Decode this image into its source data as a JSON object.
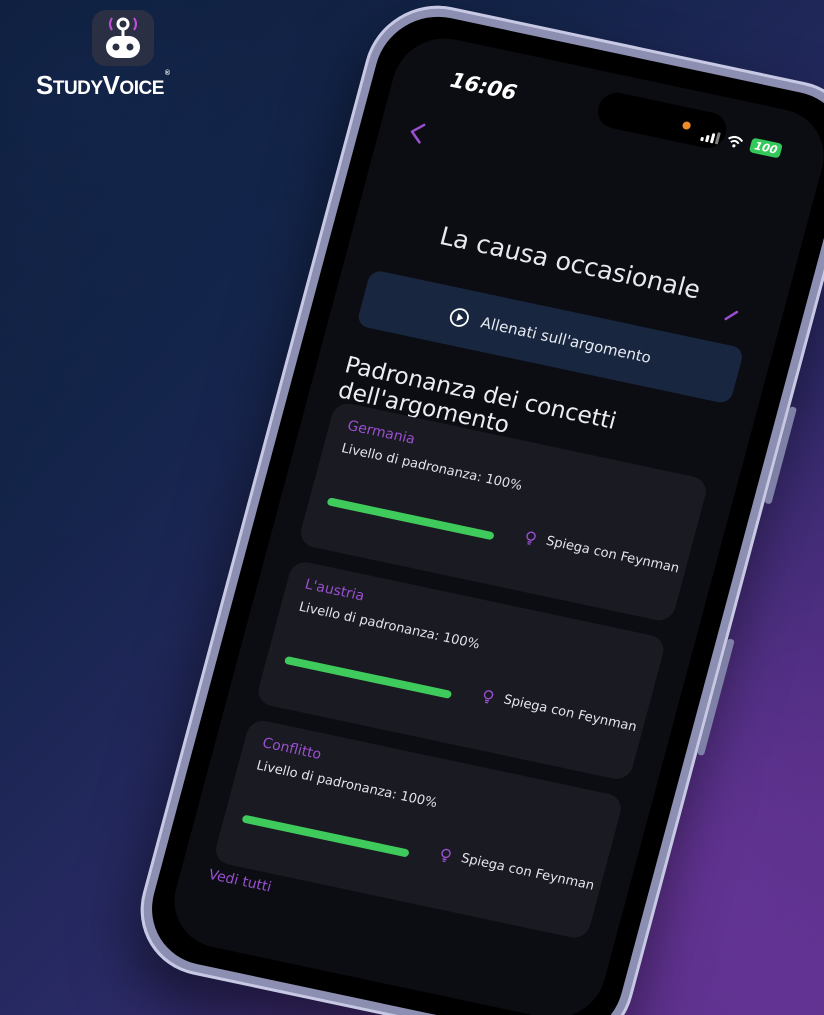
{
  "branding": {
    "logo_text_main_1": "S",
    "logo_text_small_1": "TUDY",
    "logo_text_main_2": "V",
    "logo_text_small_2": "OICE",
    "logo_mark": "®"
  },
  "status_bar": {
    "time": "16:06",
    "battery": "100"
  },
  "page": {
    "title": "La causa occasionale",
    "train_button_label": "Allenati sull'argomento",
    "section_title": "Padronanza dei concetti dell'argomento",
    "see_all_label": "Vedi tutti"
  },
  "concepts": [
    {
      "name": "Germania",
      "level_text": "Livello di padronanza: 100%",
      "mastery": 1.0,
      "feynman_label": "Spiega con Feynman"
    },
    {
      "name": "L'austria",
      "level_text": "Livello di padronanza: 100%",
      "mastery": 1.0,
      "feynman_label": "Spiega con Feynman"
    },
    {
      "name": "Conflitto",
      "level_text": "Livello di padronanza: 100%",
      "mastery": 1.0,
      "feynman_label": "Spiega con Feynman"
    }
  ],
  "colors": {
    "accent_purple": "#9a4fd0",
    "progress_green": "#3ecb5c",
    "button_bg": "#182640",
    "battery_green": "#34c759"
  },
  "icons": [
    "back-arrow-icon",
    "edit-icon",
    "play-icon",
    "lightbulb-icon",
    "signal-icon",
    "wifi-icon",
    "robot-logo-icon"
  ]
}
